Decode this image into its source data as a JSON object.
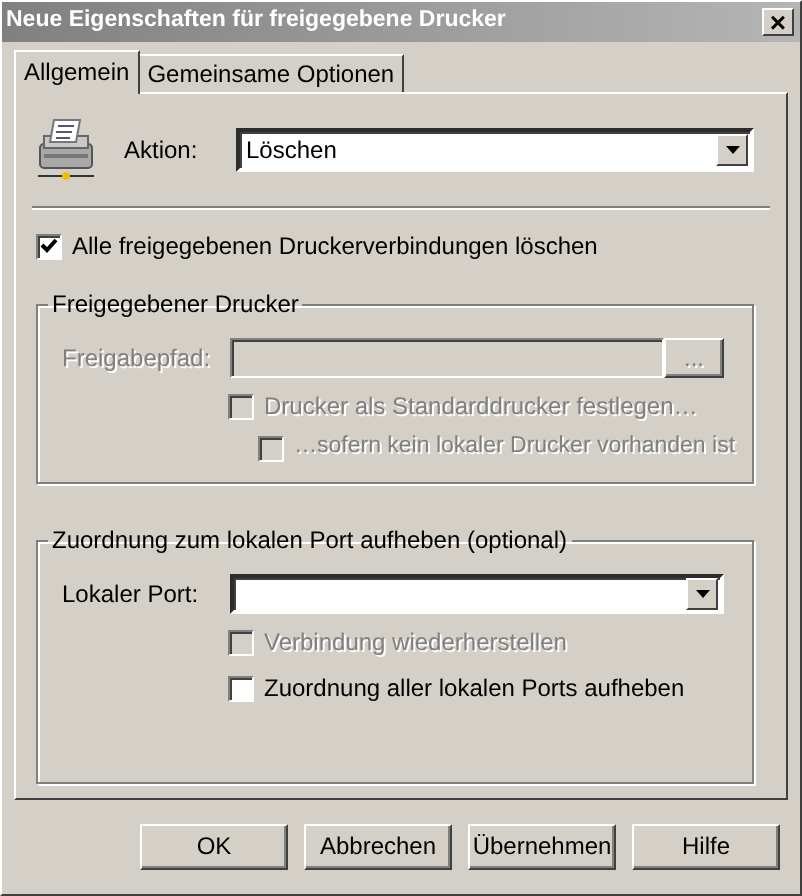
{
  "window": {
    "title": "Neue Eigenschaften für freigegebene Drucker",
    "close": "×"
  },
  "tabs": [
    {
      "label": "Allgemein",
      "selected": true
    },
    {
      "label": "Gemeinsame Optionen",
      "selected": false
    }
  ],
  "action": {
    "label": "Aktion:",
    "value": "Löschen"
  },
  "delete_all": {
    "label": "Alle freigegebenen Druckerverbindungen löschen",
    "checked": true,
    "disabled": false
  },
  "shared_printer": {
    "title": "Freigegebener Drucker",
    "path_label": "Freigabepfad:",
    "disabled": true,
    "browse_button": "...",
    "options": [
      {
        "label": "Drucker als Standarddrucker festlegen…",
        "checked": false,
        "disabled": true,
        "children": [
          {
            "label": "…sofern kein lokaler Drucker vorhanden ist",
            "checked": false,
            "disabled": true
          }
        ]
      }
    ]
  },
  "port_group": {
    "title": "Zuordnung zum lokalen Port aufheben (optional)",
    "port_label": "Lokaler Port:",
    "options": [
      {
        "label": "Verbindung wiederherstellen",
        "checked": false,
        "disabled": true
      },
      {
        "label": "Zuordnung aller lokalen Ports aufheben",
        "checked": false,
        "disabled": false
      }
    ]
  },
  "buttons": [
    "OK",
    "Abbrechen",
    "Übernehmen",
    "Hilfe"
  ]
}
